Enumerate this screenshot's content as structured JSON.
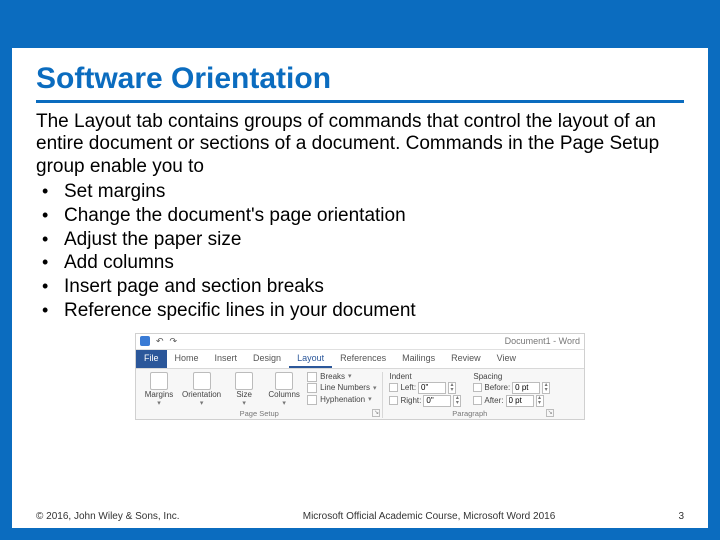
{
  "title": "Software Orientation",
  "intro": "The Layout tab contains groups of commands that control the layout of an entire document or sections of a document. Commands in the Page Setup group enable you to",
  "bullets": [
    "Set margins",
    "Change the document's page orientation",
    "Adjust the paper size",
    "Add columns",
    "Insert page and section breaks",
    "Reference specific lines in your document"
  ],
  "ribbon": {
    "docname": "Document1 - Word",
    "tabs": {
      "file": "File",
      "home": "Home",
      "insert": "Insert",
      "design": "Design",
      "layout": "Layout",
      "references": "References",
      "mailings": "Mailings",
      "review": "Review",
      "view": "View"
    },
    "page_setup": {
      "margins": "Margins",
      "orientation": "Orientation",
      "size": "Size",
      "columns": "Columns",
      "breaks": "Breaks",
      "line_numbers": "Line Numbers",
      "hyphenation": "Hyphenation",
      "label": "Page Setup"
    },
    "indent_spacing": {
      "indent_label": "Indent",
      "spacing_label": "Spacing",
      "left_label": "Left:",
      "right_label": "Right:",
      "before_label": "Before:",
      "after_label": "After:",
      "left_val": "0\"",
      "right_val": "0\"",
      "before_val": "0 pt",
      "after_val": "0 pt",
      "label": "Paragraph"
    }
  },
  "footer": {
    "copyright": "© 2016, John Wiley & Sons, Inc.",
    "course": "Microsoft Official Academic Course, Microsoft Word 2016",
    "page": "3"
  }
}
